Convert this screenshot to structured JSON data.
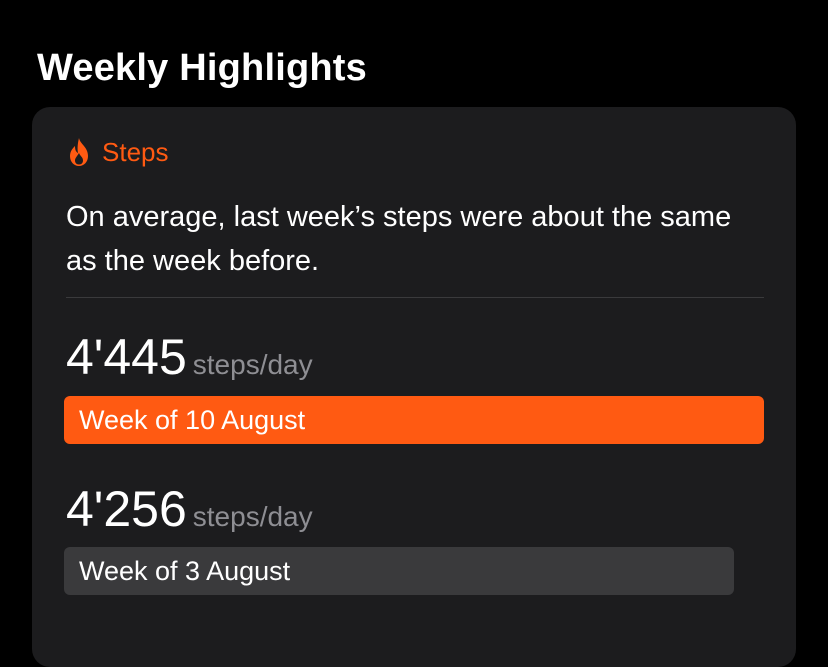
{
  "section": {
    "title": "Weekly Highlights"
  },
  "card": {
    "label": "Steps",
    "icon": "flame-icon",
    "summary": "On average, last week’s steps were about the same as the week before.",
    "colors": {
      "accent": "#ff5a12",
      "card_bg": "#1c1c1e",
      "previous_bar": "#3a3a3c",
      "secondary_text": "#8e8e93"
    },
    "current_week": {
      "value": "4'445",
      "unit": "steps/day",
      "label": "Week of 10 August",
      "steps_per_day": 4445
    },
    "previous_week": {
      "value": "4'256",
      "unit": "steps/day",
      "label": "Week of 3 August",
      "steps_per_day": 4256
    }
  }
}
